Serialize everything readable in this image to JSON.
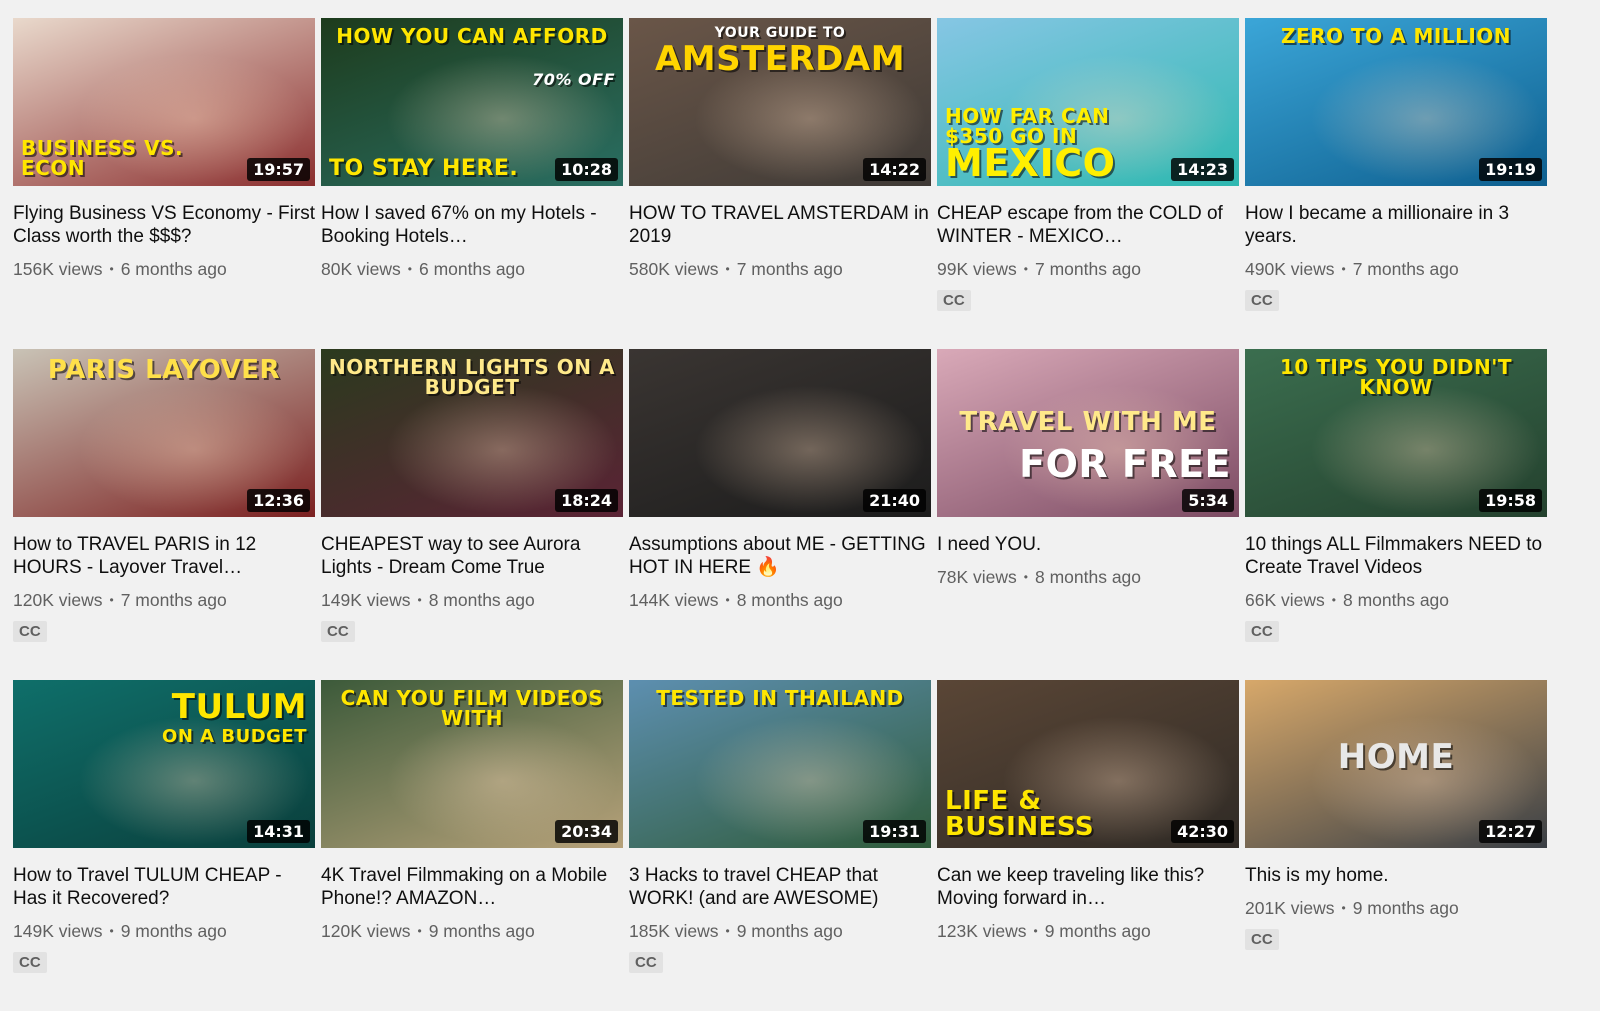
{
  "videos": [
    {
      "title": "Flying Business VS Economy - First Class worth the $$$?",
      "views": "156K views",
      "age": "6 months ago",
      "duration": "19:57",
      "cc": "",
      "overlay": "BUSINESS VS. ECON",
      "overlay_color": "#ffe600",
      "overlay_pos": "bottom",
      "bg": [
        "#e9d9cc",
        "#8b2f2f"
      ]
    },
    {
      "title": "How I saved 67% on my Hotels - Booking Hotels…",
      "views": "80K views",
      "age": "6 months ago",
      "duration": "10:28",
      "cc": "",
      "overlay": "HOW YOU CAN AFFORD",
      "overlay2": "TO STAY HERE.",
      "badge": "70% OFF",
      "overlay_color": "#ffe600",
      "overlay_pos": "top",
      "bg": [
        "#1d3b1c",
        "#2a6f63"
      ]
    },
    {
      "title": "HOW TO TRAVEL AMSTERDAM in 2019",
      "views": "580K views",
      "age": "7 months ago",
      "duration": "14:22",
      "cc": "",
      "overlay": "AMSTERDAM",
      "overlay_small": "YOUR GUIDE TO",
      "overlay_color": "#ffd400",
      "overlay_pos": "top",
      "bg": [
        "#6a5648",
        "#3f3a36"
      ]
    },
    {
      "title": "CHEAP escape from the COLD of WINTER - MEXICO…",
      "views": "99K views",
      "age": "7 months ago",
      "duration": "14:23",
      "cc": "CC",
      "overlay": "HOW FAR CAN $350 GO IN",
      "overlay2": "MEXICO",
      "overlay_color": "#ffef00",
      "overlay_pos": "bottom",
      "bg": [
        "#86c6e4",
        "#2eb8b0"
      ]
    },
    {
      "title": "How I became a millionaire in 3 years.",
      "views": "490K views",
      "age": "7 months ago",
      "duration": "19:19",
      "cc": "CC",
      "overlay": "ZERO TO A MILLION",
      "overlay_color": "#ffe600",
      "overlay_pos": "top",
      "bg": [
        "#3ba6d8",
        "#0e5f8f"
      ]
    },
    {
      "title": "How to TRAVEL PARIS in 12 HOURS - Layover Travel…",
      "views": "120K views",
      "age": "7 months ago",
      "duration": "12:36",
      "cc": "CC",
      "overlay": "PARIS LAYOVER",
      "overlay_color": "#ffe04a",
      "overlay_pos": "top",
      "bg": [
        "#c9c3b6",
        "#7b2020"
      ]
    },
    {
      "title": "CHEAPEST way to see Aurora Lights - Dream Come True",
      "views": "149K views",
      "age": "8 months ago",
      "duration": "18:24",
      "cc": "CC",
      "overlay": "NORTHERN LIGHTS ON A BUDGET",
      "overlay_color": "#ffe98a",
      "overlay_pos": "top",
      "bg": [
        "#2b3a1e",
        "#5b2335"
      ]
    },
    {
      "title": "Assumptions about ME - GETTING HOT IN HERE 🔥",
      "views": "144K views",
      "age": "8 months ago",
      "duration": "21:40",
      "cc": "",
      "overlay": "",
      "overlay_color": "#ffffff",
      "overlay_pos": "top",
      "bg": [
        "#3a3532",
        "#1c1c1c"
      ]
    },
    {
      "title": "I need YOU.",
      "views": "78K views",
      "age": "8 months ago",
      "duration": "5:34",
      "cc": "",
      "overlay": "TRAVEL WITH ME",
      "overlay2": "for FREE",
      "overlay_color": "#ffe98a",
      "overlay_pos": "middle",
      "bg": [
        "#d9a9b8",
        "#7c4b63"
      ]
    },
    {
      "title": "10 things ALL Filmmakers NEED to Create Travel Videos",
      "views": "66K views",
      "age": "8 months ago",
      "duration": "19:58",
      "cc": "CC",
      "overlay": "10 TIPS YOU DIDN'T KNOW",
      "overlay_color": "#ffe600",
      "overlay_pos": "top",
      "bg": [
        "#3b6e4f",
        "#24412e"
      ]
    },
    {
      "title": "How to Travel TULUM CHEAP - Has it Recovered?",
      "views": "149K views",
      "age": "9 months ago",
      "duration": "14:31",
      "cc": "CC",
      "overlay": "TULUM",
      "overlay2": "ON A BUDGET",
      "overlay_color": "#ffe600",
      "overlay_pos": "right",
      "bg": [
        "#0f6f6a",
        "#0a3f3c"
      ]
    },
    {
      "title": "4K Travel Filmmaking on a Mobile Phone!? AMAZON…",
      "views": "120K views",
      "age": "9 months ago",
      "duration": "20:34",
      "cc": "",
      "overlay": "CAN YOU FILM VIDEOS WITH",
      "overlay_color": "#ffe600",
      "overlay_pos": "top",
      "bg": [
        "#3c5a3a",
        "#b7a27a"
      ]
    },
    {
      "title": "3 Hacks to travel CHEAP that WORK! (and are AWESOME)",
      "views": "185K views",
      "age": "9 months ago",
      "duration": "19:31",
      "cc": "CC",
      "overlay": "TESTED IN THAILAND",
      "overlay_color": "#ffe600",
      "overlay_pos": "top",
      "bg": [
        "#5d8fb0",
        "#2f5b3a"
      ]
    },
    {
      "title": "Can we keep traveling like this? Moving forward in…",
      "views": "123K views",
      "age": "9 months ago",
      "duration": "42:30",
      "cc": "",
      "overlay": "LIFE & BUSINESS",
      "overlay_color": "#ffe600",
      "overlay_pos": "bottom",
      "bg": [
        "#5a4636",
        "#2f2a25"
      ]
    },
    {
      "title": "This is my home.",
      "views": "201K views",
      "age": "9 months ago",
      "duration": "12:27",
      "cc": "CC",
      "overlay": "HOME",
      "overlay_color": "#e8e8e8",
      "overlay_pos": "middle",
      "bg": [
        "#d7a86a",
        "#3a3f45"
      ]
    }
  ]
}
